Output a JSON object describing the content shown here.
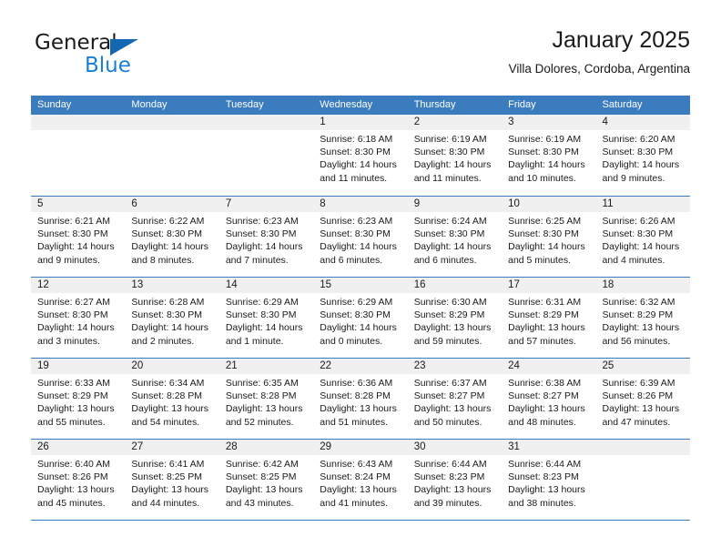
{
  "brand": {
    "name_top": "General",
    "name_bottom": "Blue",
    "accent_color": "#1a7fd4",
    "triangle_color": "#1268b3"
  },
  "header": {
    "title": "January 2025",
    "subtitle": "Villa Dolores, Cordoba, Argentina"
  },
  "calendar": {
    "header_bg": "#3a7cbe",
    "day_number_bg": "#f0f0f0",
    "weekdays": [
      "Sunday",
      "Monday",
      "Tuesday",
      "Wednesday",
      "Thursday",
      "Friday",
      "Saturday"
    ],
    "weeks": [
      [
        {
          "day": "",
          "lines": []
        },
        {
          "day": "",
          "lines": []
        },
        {
          "day": "",
          "lines": []
        },
        {
          "day": "1",
          "lines": [
            "Sunrise: 6:18 AM",
            "Sunset: 8:30 PM",
            "Daylight: 14 hours",
            "and 11 minutes."
          ]
        },
        {
          "day": "2",
          "lines": [
            "Sunrise: 6:19 AM",
            "Sunset: 8:30 PM",
            "Daylight: 14 hours",
            "and 11 minutes."
          ]
        },
        {
          "day": "3",
          "lines": [
            "Sunrise: 6:19 AM",
            "Sunset: 8:30 PM",
            "Daylight: 14 hours",
            "and 10 minutes."
          ]
        },
        {
          "day": "4",
          "lines": [
            "Sunrise: 6:20 AM",
            "Sunset: 8:30 PM",
            "Daylight: 14 hours",
            "and 9 minutes."
          ]
        }
      ],
      [
        {
          "day": "5",
          "lines": [
            "Sunrise: 6:21 AM",
            "Sunset: 8:30 PM",
            "Daylight: 14 hours",
            "and 9 minutes."
          ]
        },
        {
          "day": "6",
          "lines": [
            "Sunrise: 6:22 AM",
            "Sunset: 8:30 PM",
            "Daylight: 14 hours",
            "and 8 minutes."
          ]
        },
        {
          "day": "7",
          "lines": [
            "Sunrise: 6:23 AM",
            "Sunset: 8:30 PM",
            "Daylight: 14 hours",
            "and 7 minutes."
          ]
        },
        {
          "day": "8",
          "lines": [
            "Sunrise: 6:23 AM",
            "Sunset: 8:30 PM",
            "Daylight: 14 hours",
            "and 6 minutes."
          ]
        },
        {
          "day": "9",
          "lines": [
            "Sunrise: 6:24 AM",
            "Sunset: 8:30 PM",
            "Daylight: 14 hours",
            "and 6 minutes."
          ]
        },
        {
          "day": "10",
          "lines": [
            "Sunrise: 6:25 AM",
            "Sunset: 8:30 PM",
            "Daylight: 14 hours",
            "and 5 minutes."
          ]
        },
        {
          "day": "11",
          "lines": [
            "Sunrise: 6:26 AM",
            "Sunset: 8:30 PM",
            "Daylight: 14 hours",
            "and 4 minutes."
          ]
        }
      ],
      [
        {
          "day": "12",
          "lines": [
            "Sunrise: 6:27 AM",
            "Sunset: 8:30 PM",
            "Daylight: 14 hours",
            "and 3 minutes."
          ]
        },
        {
          "day": "13",
          "lines": [
            "Sunrise: 6:28 AM",
            "Sunset: 8:30 PM",
            "Daylight: 14 hours",
            "and 2 minutes."
          ]
        },
        {
          "day": "14",
          "lines": [
            "Sunrise: 6:29 AM",
            "Sunset: 8:30 PM",
            "Daylight: 14 hours",
            "and 1 minute."
          ]
        },
        {
          "day": "15",
          "lines": [
            "Sunrise: 6:29 AM",
            "Sunset: 8:30 PM",
            "Daylight: 14 hours",
            "and 0 minutes."
          ]
        },
        {
          "day": "16",
          "lines": [
            "Sunrise: 6:30 AM",
            "Sunset: 8:29 PM",
            "Daylight: 13 hours",
            "and 59 minutes."
          ]
        },
        {
          "day": "17",
          "lines": [
            "Sunrise: 6:31 AM",
            "Sunset: 8:29 PM",
            "Daylight: 13 hours",
            "and 57 minutes."
          ]
        },
        {
          "day": "18",
          "lines": [
            "Sunrise: 6:32 AM",
            "Sunset: 8:29 PM",
            "Daylight: 13 hours",
            "and 56 minutes."
          ]
        }
      ],
      [
        {
          "day": "19",
          "lines": [
            "Sunrise: 6:33 AM",
            "Sunset: 8:29 PM",
            "Daylight: 13 hours",
            "and 55 minutes."
          ]
        },
        {
          "day": "20",
          "lines": [
            "Sunrise: 6:34 AM",
            "Sunset: 8:28 PM",
            "Daylight: 13 hours",
            "and 54 minutes."
          ]
        },
        {
          "day": "21",
          "lines": [
            "Sunrise: 6:35 AM",
            "Sunset: 8:28 PM",
            "Daylight: 13 hours",
            "and 52 minutes."
          ]
        },
        {
          "day": "22",
          "lines": [
            "Sunrise: 6:36 AM",
            "Sunset: 8:28 PM",
            "Daylight: 13 hours",
            "and 51 minutes."
          ]
        },
        {
          "day": "23",
          "lines": [
            "Sunrise: 6:37 AM",
            "Sunset: 8:27 PM",
            "Daylight: 13 hours",
            "and 50 minutes."
          ]
        },
        {
          "day": "24",
          "lines": [
            "Sunrise: 6:38 AM",
            "Sunset: 8:27 PM",
            "Daylight: 13 hours",
            "and 48 minutes."
          ]
        },
        {
          "day": "25",
          "lines": [
            "Sunrise: 6:39 AM",
            "Sunset: 8:26 PM",
            "Daylight: 13 hours",
            "and 47 minutes."
          ]
        }
      ],
      [
        {
          "day": "26",
          "lines": [
            "Sunrise: 6:40 AM",
            "Sunset: 8:26 PM",
            "Daylight: 13 hours",
            "and 45 minutes."
          ]
        },
        {
          "day": "27",
          "lines": [
            "Sunrise: 6:41 AM",
            "Sunset: 8:25 PM",
            "Daylight: 13 hours",
            "and 44 minutes."
          ]
        },
        {
          "day": "28",
          "lines": [
            "Sunrise: 6:42 AM",
            "Sunset: 8:25 PM",
            "Daylight: 13 hours",
            "and 43 minutes."
          ]
        },
        {
          "day": "29",
          "lines": [
            "Sunrise: 6:43 AM",
            "Sunset: 8:24 PM",
            "Daylight: 13 hours",
            "and 41 minutes."
          ]
        },
        {
          "day": "30",
          "lines": [
            "Sunrise: 6:44 AM",
            "Sunset: 8:23 PM",
            "Daylight: 13 hours",
            "and 39 minutes."
          ]
        },
        {
          "day": "31",
          "lines": [
            "Sunrise: 6:44 AM",
            "Sunset: 8:23 PM",
            "Daylight: 13 hours",
            "and 38 minutes."
          ]
        },
        {
          "day": "",
          "lines": []
        }
      ]
    ]
  }
}
